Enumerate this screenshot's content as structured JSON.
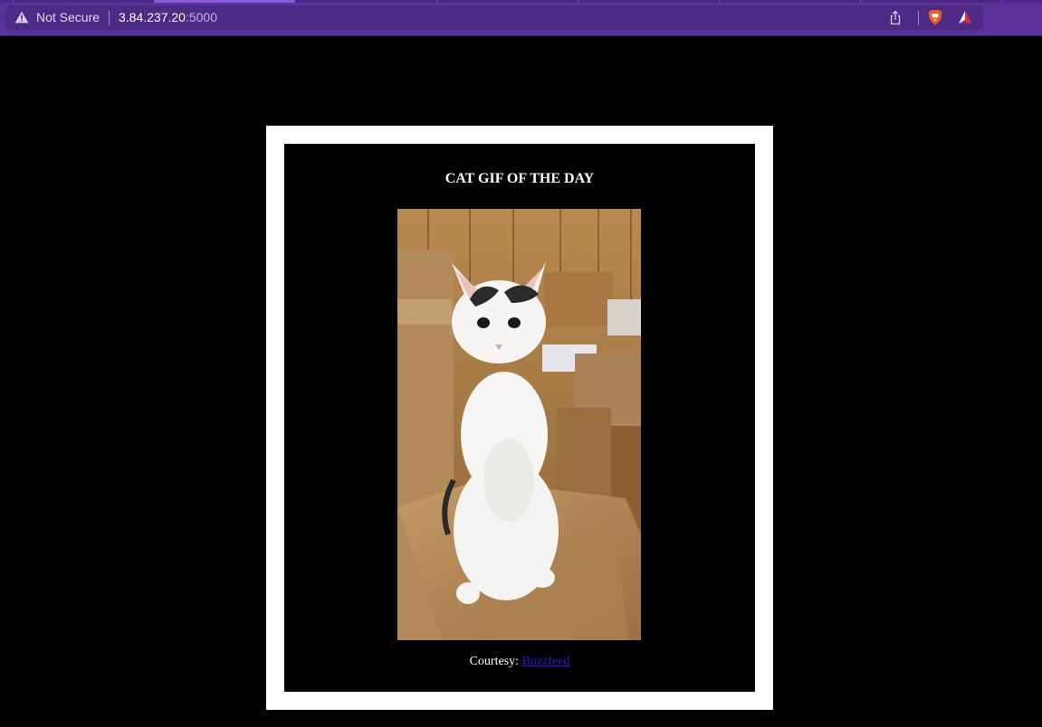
{
  "browser": {
    "security_label": "Not Secure",
    "url_host": "3.84.237.20",
    "url_port": ":5000",
    "icons": {
      "security": "warning-triangle-icon",
      "share": "share-icon",
      "shields": "brave-shields-icon",
      "rewards": "brave-rewards-icon"
    },
    "colors": {
      "chrome": "#5b3197",
      "urlbar": "#4d2a86"
    }
  },
  "page": {
    "title": "CAT GIF OF THE DAY",
    "courtesy_label": "Courtesy: ",
    "source_link": "Buzzfeed",
    "colors": {
      "background": "#000000",
      "card_border": "#ffffff",
      "link": "#2a1bd1"
    }
  }
}
